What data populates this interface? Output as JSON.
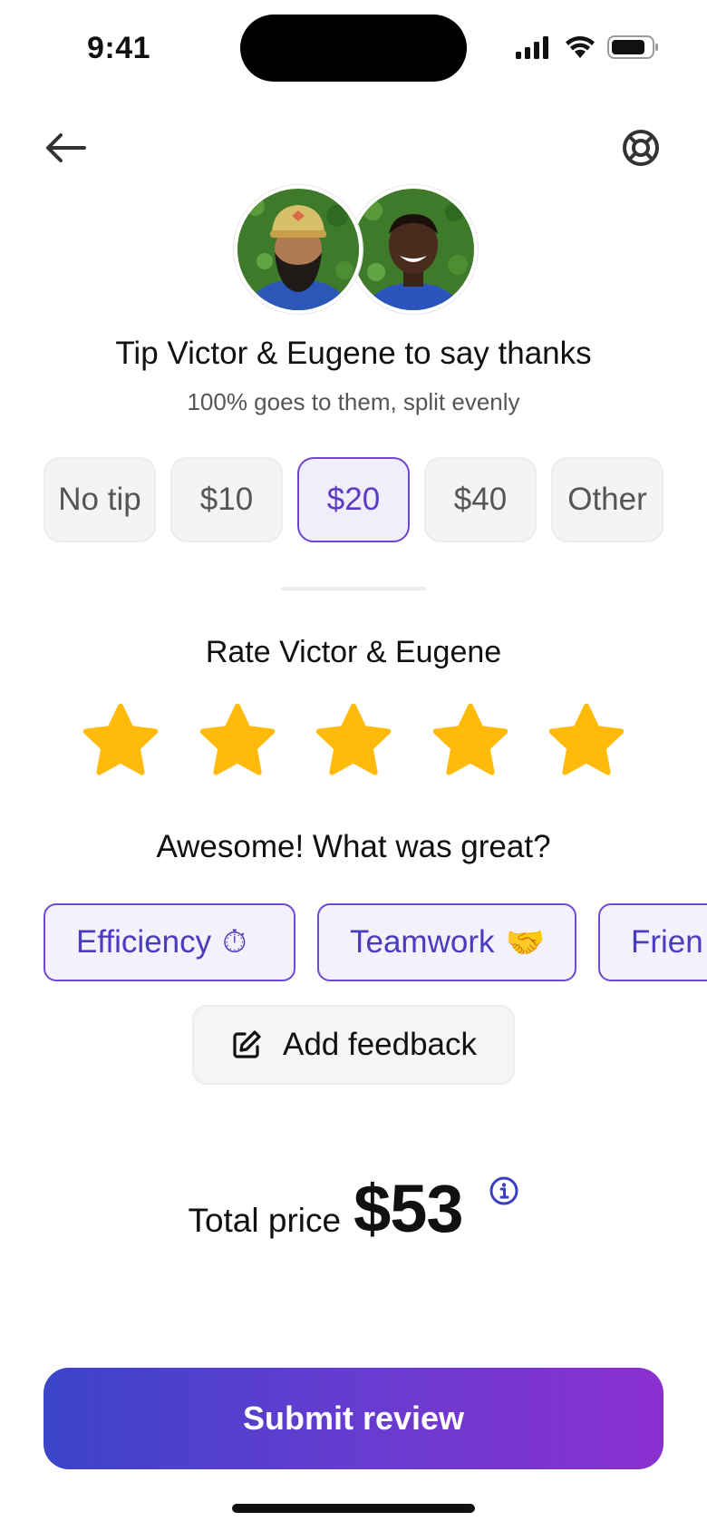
{
  "status_bar": {
    "time": "9:41"
  },
  "header": {
    "back_icon": "arrow-left-icon",
    "help_icon": "lifebuoy-icon"
  },
  "avatars": [
    {
      "name": "Victor"
    },
    {
      "name": "Eugene"
    }
  ],
  "tip": {
    "title": "Tip Victor & Eugene to say thanks",
    "subtitle": "100% goes to them, split evenly",
    "options": [
      "No tip",
      "$10",
      "$20",
      "$40",
      "Other"
    ],
    "selected": "$20"
  },
  "rating": {
    "title": "Rate Victor & Eugene",
    "stars_filled": 5,
    "stars_total": 5,
    "star_color": "#FFBA0A"
  },
  "feedback": {
    "title": "Awesome! What was great?",
    "chips": [
      {
        "label": "Efficiency",
        "emoji": "⏱"
      },
      {
        "label": "Teamwork",
        "emoji": "🤝"
      },
      {
        "label": "Frien",
        "emoji": ""
      }
    ],
    "add_feedback_label": "Add feedback"
  },
  "total": {
    "label": "Total price",
    "amount": "$53"
  },
  "submit_label": "Submit review",
  "colors": {
    "accent": "#5B3BC4",
    "gradient_start": "#3B44C8",
    "gradient_end": "#8A2FD0"
  }
}
